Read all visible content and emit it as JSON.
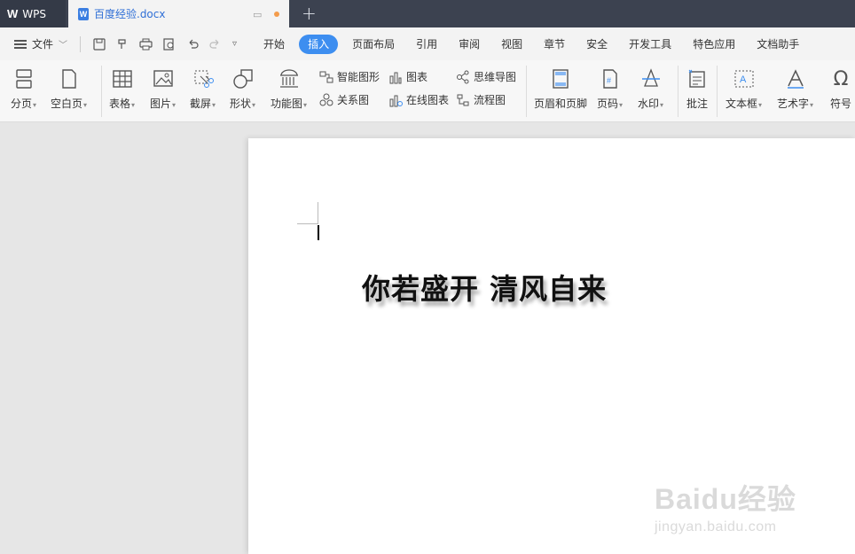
{
  "titlebar": {
    "app_label": "WPS",
    "doc_tab_title": "百度经验.docx"
  },
  "menubar": {
    "file_label": "文件",
    "tabs": [
      "开始",
      "插入",
      "页面布局",
      "引用",
      "审阅",
      "视图",
      "章节",
      "安全",
      "开发工具",
      "特色应用",
      "文档助手"
    ],
    "active_tab": "插入"
  },
  "ribbon": {
    "fenye": "分页",
    "kongbaiye": "空白页",
    "biaoge": "表格",
    "tupian": "图片",
    "jieping": "截屏",
    "xingzhuang": "形状",
    "gongnengtu": "功能图",
    "zhineng": "智能图形",
    "tubiao": "图表",
    "siwei": "思维导图",
    "guanxi": "关系图",
    "zaixian": "在线图表",
    "liucheng": "流程图",
    "yemei": "页眉和页脚",
    "yema": "页码",
    "shuiyin": "水印",
    "pizhu": "批注",
    "wenbenkuang": "文本框",
    "yishuzi": "艺术字",
    "fuhao": "符号"
  },
  "document": {
    "headline": "你若盛开  清风自来"
  },
  "watermark": {
    "brand": "Baidu经验",
    "url": "jingyan.baidu.com"
  },
  "colors": {
    "accent": "#3d8ef0",
    "titlebar": "#3c4250"
  }
}
